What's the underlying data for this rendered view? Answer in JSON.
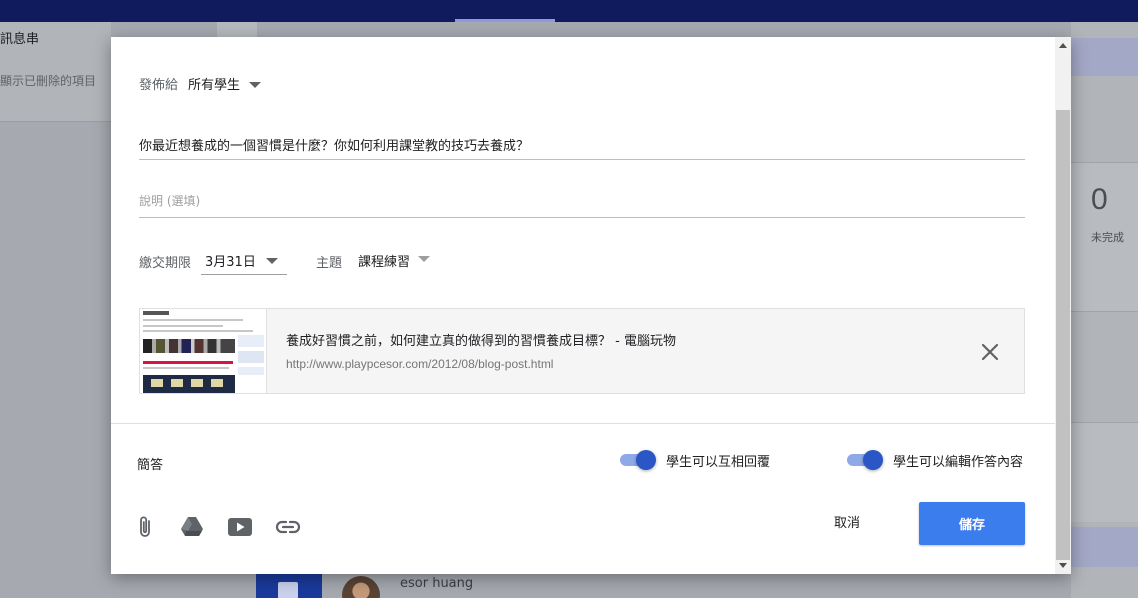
{
  "background": {
    "left_title": "訊息串",
    "left_sub": "顯示已刪除的項目",
    "right_count": "0",
    "right_count_label": "未完成",
    "bottom_user": "esor huang"
  },
  "dialog": {
    "assign": {
      "label": "發佈給",
      "value": "所有學生"
    },
    "question_title": "你最近想養成的一個習慣是什麼？你如何利用課堂教的技巧去養成？",
    "description_placeholder": "說明 (選填)",
    "due": {
      "label": "繳交期限",
      "value": "3月31日"
    },
    "topic": {
      "label": "主題",
      "value": "課程練習"
    },
    "attachment": {
      "title": "養成好習慣之前，如何建立真的做得到的習慣養成目標？ - 電腦玩物",
      "url": "http://www.playpcesor.com/2012/08/blog-post.html",
      "thumb_header": "電腦玩物"
    },
    "footer": {
      "question_type": "簡答",
      "toggle_reply": {
        "label": "學生可以互相回覆",
        "on": true
      },
      "toggle_edit": {
        "label": "學生可以編輯作答內容",
        "on": true
      },
      "attach_icons": [
        "paperclip-icon",
        "google-drive-icon",
        "youtube-icon",
        "link-icon"
      ],
      "cancel_label": "取消",
      "save_label": "儲存"
    }
  },
  "colors": {
    "topbar": "#0f1b5c",
    "accent": "#3b7ded",
    "toggle_knob": "#2a56c6",
    "toggle_track": "#8ea8e8"
  }
}
